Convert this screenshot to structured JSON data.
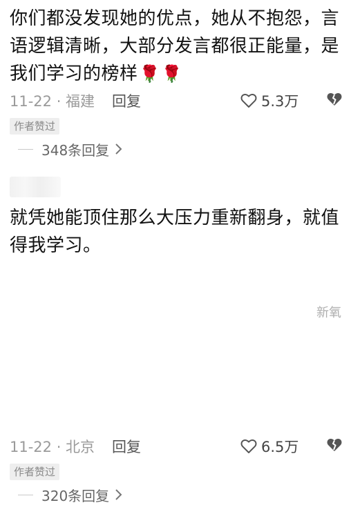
{
  "comments": [
    {
      "text": "你们都没发现她的优点，她从不抱怨，言语逻辑清晰，大部分发言都很正能量，是我们学习的榜样",
      "emojis": [
        "🌹",
        "🌹"
      ],
      "time_location": "11-22 · 福建",
      "reply_label": "回复",
      "likes": "5.3万",
      "badge": "作者赞过",
      "replies_label": "348条回复"
    },
    {
      "text": "就凭她能顶住那么大压力重新翻身，就值得我学习。",
      "time_location": "11-22 · 北京",
      "reply_label": "回复",
      "likes": "6.5万",
      "badge": "作者赞过",
      "replies_label": "320条回复"
    }
  ],
  "watermark": "新氧",
  "colors": {
    "text": "#111111",
    "meta": "#9a9a9a",
    "badge_bg": "#eeeeee"
  },
  "icons": [
    "rose-icon",
    "heart-outline-icon",
    "broken-heart-icon",
    "chevron-right-icon"
  ]
}
